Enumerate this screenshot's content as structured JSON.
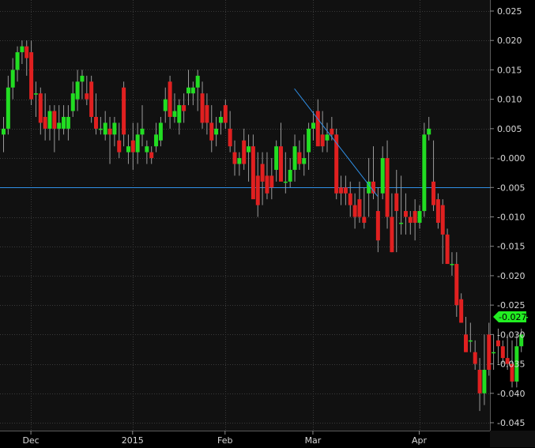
{
  "chart_data": {
    "type": "candlestick",
    "title": "",
    "xlabel": "",
    "ylabel": "",
    "ylim": [
      -0.047,
      0.027
    ],
    "y_ticks": [
      "0.025",
      "0.020",
      "0.015",
      "0.010",
      "0.005",
      "-0.000",
      "-0.005",
      "-0.010",
      "-0.015",
      "-0.020",
      "-0.025",
      "-0.030",
      "-0.035",
      "-0.040",
      "-0.045"
    ],
    "x_ticks": [
      {
        "label": "Dec",
        "index": 6
      },
      {
        "label": "2015",
        "index": 28
      },
      {
        "label": "Feb",
        "index": 48
      },
      {
        "label": "Mar",
        "index": 67
      },
      {
        "label": "Apr",
        "index": 90
      }
    ],
    "grid": "horizontal and vertical, dotted",
    "colors": {
      "up": "#22dd22",
      "down": "#e02020",
      "line": "#2f8fe6",
      "wick": "#9a9a9a",
      "label_bg": "#22ee22"
    },
    "last_value_label": "-0.027",
    "last_value": -0.027,
    "horizontal_line": -0.005,
    "trend_line": {
      "from": {
        "index": 63,
        "y": 0.0118
      },
      "to": {
        "index": 81,
        "y": -0.0065
      }
    },
    "candles": [
      {
        "o": 0.004,
        "h": 0.007,
        "l": 0.001,
        "c": 0.005
      },
      {
        "o": 0.005,
        "h": 0.014,
        "l": 0.004,
        "c": 0.012
      },
      {
        "o": 0.012,
        "h": 0.017,
        "l": 0.01,
        "c": 0.015
      },
      {
        "o": 0.015,
        "h": 0.019,
        "l": 0.013,
        "c": 0.018
      },
      {
        "o": 0.018,
        "h": 0.02,
        "l": 0.016,
        "c": 0.019
      },
      {
        "o": 0.019,
        "h": 0.02,
        "l": 0.014,
        "c": 0.017
      },
      {
        "o": 0.018,
        "h": 0.02,
        "l": 0.009,
        "c": 0.01
      },
      {
        "o": 0.011,
        "h": 0.013,
        "l": 0.007,
        "c": 0.011
      },
      {
        "o": 0.011,
        "h": 0.012,
        "l": 0.004,
        "c": 0.006
      },
      {
        "o": 0.007,
        "h": 0.011,
        "l": 0.003,
        "c": 0.005
      },
      {
        "o": 0.005,
        "h": 0.009,
        "l": 0.003,
        "c": 0.008
      },
      {
        "o": 0.008,
        "h": 0.009,
        "l": 0.001,
        "c": 0.005
      },
      {
        "o": 0.005,
        "h": 0.009,
        "l": 0.003,
        "c": 0.006
      },
      {
        "o": 0.005,
        "h": 0.009,
        "l": 0.004,
        "c": 0.007
      },
      {
        "o": 0.005,
        "h": 0.009,
        "l": 0.003,
        "c": 0.007
      },
      {
        "o": 0.008,
        "h": 0.013,
        "l": 0.007,
        "c": 0.011
      },
      {
        "o": 0.01,
        "h": 0.015,
        "l": 0.008,
        "c": 0.013
      },
      {
        "o": 0.013,
        "h": 0.015,
        "l": 0.01,
        "c": 0.014
      },
      {
        "o": 0.011,
        "h": 0.014,
        "l": 0.009,
        "c": 0.01
      },
      {
        "o": 0.013,
        "h": 0.014,
        "l": 0.006,
        "c": 0.007
      },
      {
        "o": 0.007,
        "h": 0.011,
        "l": 0.004,
        "c": 0.005
      },
      {
        "o": 0.005,
        "h": 0.007,
        "l": 0.004,
        "c": 0.005
      },
      {
        "o": 0.004,
        "h": 0.008,
        "l": 0.003,
        "c": 0.006
      },
      {
        "o": 0.005,
        "h": 0.007,
        "l": -0.001,
        "c": 0.004
      },
      {
        "o": 0.004,
        "h": 0.007,
        "l": 0.002,
        "c": 0.006
      },
      {
        "o": 0.003,
        "h": 0.006,
        "l": 0.0,
        "c": 0.001
      },
      {
        "o": 0.012,
        "h": 0.013,
        "l": 0.002,
        "c": 0.004
      },
      {
        "o": 0.001,
        "h": 0.004,
        "l": -0.001,
        "c": 0.002
      },
      {
        "o": 0.003,
        "h": 0.006,
        "l": -0.002,
        "c": 0.001
      },
      {
        "o": 0.001,
        "h": 0.006,
        "l": -0.001,
        "c": 0.004
      },
      {
        "o": 0.004,
        "h": 0.009,
        "l": 0.002,
        "c": 0.005
      },
      {
        "o": 0.001,
        "h": 0.003,
        "l": -0.001,
        "c": 0.002
      },
      {
        "o": 0.001,
        "h": 0.002,
        "l": -0.001,
        "c": 0.0
      },
      {
        "o": 0.002,
        "h": 0.006,
        "l": 0.001,
        "c": 0.004
      },
      {
        "o": 0.003,
        "h": 0.007,
        "l": 0.002,
        "c": 0.006
      },
      {
        "o": 0.008,
        "h": 0.012,
        "l": 0.006,
        "c": 0.01
      },
      {
        "o": 0.013,
        "h": 0.014,
        "l": 0.005,
        "c": 0.007
      },
      {
        "o": 0.007,
        "h": 0.011,
        "l": 0.006,
        "c": 0.008
      },
      {
        "o": 0.006,
        "h": 0.01,
        "l": 0.004,
        "c": 0.009
      },
      {
        "o": 0.009,
        "h": 0.011,
        "l": 0.006,
        "c": 0.008
      },
      {
        "o": 0.011,
        "h": 0.015,
        "l": 0.009,
        "c": 0.012
      },
      {
        "o": 0.011,
        "h": 0.013,
        "l": 0.009,
        "c": 0.012
      },
      {
        "o": 0.012,
        "h": 0.015,
        "l": 0.008,
        "c": 0.014
      },
      {
        "o": 0.011,
        "h": 0.013,
        "l": 0.005,
        "c": 0.006
      },
      {
        "o": 0.009,
        "h": 0.011,
        "l": 0.004,
        "c": 0.006
      },
      {
        "o": 0.006,
        "h": 0.009,
        "l": 0.001,
        "c": 0.003
      },
      {
        "o": 0.004,
        "h": 0.007,
        "l": 0.002,
        "c": 0.005
      },
      {
        "o": 0.006,
        "h": 0.008,
        "l": 0.004,
        "c": 0.007
      },
      {
        "o": 0.009,
        "h": 0.01,
        "l": 0.005,
        "c": 0.006
      },
      {
        "o": 0.005,
        "h": 0.008,
        "l": 0.001,
        "c": 0.002
      },
      {
        "o": 0.001,
        "h": 0.003,
        "l": -0.003,
        "c": -0.001
      },
      {
        "o": -0.001,
        "h": 0.001,
        "l": -0.003,
        "c": 0.0
      },
      {
        "o": 0.003,
        "h": 0.005,
        "l": -0.002,
        "c": -0.001
      },
      {
        "o": 0.001,
        "h": 0.004,
        "l": -0.004,
        "c": 0.002
      },
      {
        "o": 0.002,
        "h": 0.004,
        "l": -0.006,
        "c": -0.007
      },
      {
        "o": -0.003,
        "h": 0.001,
        "l": -0.01,
        "c": -0.008
      },
      {
        "o": -0.001,
        "h": 0.001,
        "l": -0.008,
        "c": -0.004
      },
      {
        "o": -0.003,
        "h": 0.001,
        "l": -0.007,
        "c": -0.006
      },
      {
        "o": -0.003,
        "h": 0.0,
        "l": -0.007,
        "c": -0.005
      },
      {
        "o": -0.002,
        "h": 0.003,
        "l": -0.004,
        "c": 0.002
      },
      {
        "o": 0.002,
        "h": 0.006,
        "l": -0.003,
        "c": -0.004
      },
      {
        "o": -0.004,
        "h": 0.001,
        "l": -0.006,
        "c": -0.004
      },
      {
        "o": -0.004,
        "h": 0.0,
        "l": -0.005,
        "c": -0.002
      },
      {
        "o": -0.002,
        "h": 0.004,
        "l": -0.004,
        "c": 0.002
      },
      {
        "o": 0.001,
        "h": 0.003,
        "l": -0.002,
        "c": -0.001
      },
      {
        "o": -0.001,
        "h": 0.004,
        "l": -0.003,
        "c": 0.0
      },
      {
        "o": 0.001,
        "h": 0.006,
        "l": -0.002,
        "c": 0.005
      },
      {
        "o": 0.005,
        "h": 0.008,
        "l": 0.003,
        "c": 0.006
      },
      {
        "o": 0.008,
        "h": 0.01,
        "l": 0.003,
        "c": 0.002
      },
      {
        "o": 0.004,
        "h": 0.008,
        "l": 0.001,
        "c": 0.002
      },
      {
        "o": 0.003,
        "h": 0.006,
        "l": 0.001,
        "c": 0.004
      },
      {
        "o": 0.005,
        "h": 0.007,
        "l": 0.003,
        "c": 0.004
      },
      {
        "o": 0.004,
        "h": 0.005,
        "l": -0.007,
        "c": -0.006
      },
      {
        "o": -0.005,
        "h": -0.003,
        "l": -0.008,
        "c": -0.006
      },
      {
        "o": -0.005,
        "h": -0.003,
        "l": -0.008,
        "c": -0.006
      },
      {
        "o": -0.006,
        "h": -0.004,
        "l": -0.01,
        "c": -0.008
      },
      {
        "o": -0.008,
        "h": -0.006,
        "l": -0.012,
        "c": -0.01
      },
      {
        "o": -0.007,
        "h": -0.004,
        "l": -0.011,
        "c": -0.01
      },
      {
        "o": -0.01,
        "h": -0.005,
        "l": -0.012,
        "c": -0.011
      },
      {
        "o": -0.006,
        "h": 0.0,
        "l": -0.01,
        "c": -0.004
      },
      {
        "o": -0.004,
        "h": 0.002,
        "l": -0.007,
        "c": -0.006
      },
      {
        "o": -0.009,
        "h": -0.005,
        "l": -0.016,
        "c": -0.014
      }
    ],
    "candles_tail": [
      {
        "o": -0.006,
        "h": 0.002,
        "l": -0.007,
        "c": 0.0
      },
      {
        "o": 0.0,
        "h": 0.003,
        "l": -0.012,
        "c": -0.01
      },
      {
        "o": -0.01,
        "h": -0.006,
        "l": -0.016,
        "c": -0.016
      },
      {
        "o": -0.006,
        "h": -0.002,
        "l": -0.016,
        "c": -0.009
      },
      {
        "o": -0.011,
        "h": -0.003,
        "l": -0.013,
        "c": -0.011
      },
      {
        "o": -0.009,
        "h": -0.006,
        "l": -0.013,
        "c": -0.01
      },
      {
        "o": -0.01,
        "h": -0.009,
        "l": -0.013,
        "c": -0.011
      },
      {
        "o": -0.009,
        "h": -0.007,
        "l": -0.014,
        "c": -0.011
      },
      {
        "o": -0.011,
        "h": -0.008,
        "l": -0.012,
        "c": -0.009
      },
      {
        "o": -0.009,
        "h": 0.006,
        "l": -0.01,
        "c": 0.004
      },
      {
        "o": 0.004,
        "h": 0.007,
        "l": 0.003,
        "c": 0.005
      },
      {
        "o": -0.004,
        "h": 0.003,
        "l": -0.009,
        "c": -0.008
      },
      {
        "o": -0.007,
        "h": -0.006,
        "l": -0.012,
        "c": -0.011
      },
      {
        "o": -0.008,
        "h": -0.007,
        "l": -0.018,
        "c": -0.013
      },
      {
        "o": -0.013,
        "h": -0.012,
        "l": -0.018,
        "c": -0.018
      },
      {
        "o": -0.018,
        "h": -0.016,
        "l": -0.02,
        "c": -0.018
      },
      {
        "o": -0.018,
        "h": -0.016,
        "l": -0.027,
        "c": -0.025
      },
      {
        "o": -0.024,
        "h": -0.023,
        "l": -0.028,
        "c": -0.028
      },
      {
        "o": -0.03,
        "h": -0.027,
        "l": -0.033,
        "c": -0.033
      },
      {
        "o": -0.031,
        "h": -0.028,
        "l": -0.033,
        "c": -0.031
      },
      {
        "o": -0.033,
        "h": -0.031,
        "l": -0.036,
        "c": -0.035
      },
      {
        "o": -0.036,
        "h": -0.034,
        "l": -0.043,
        "c": -0.04
      },
      {
        "o": -0.04,
        "h": -0.03,
        "l": -0.042,
        "c": -0.036
      },
      {
        "o": -0.03,
        "h": -0.028,
        "l": -0.037,
        "c": -0.036
      },
      {
        "o": -0.033,
        "h": -0.03,
        "l": -0.036,
        "c": -0.033
      },
      {
        "o": -0.031,
        "h": -0.029,
        "l": -0.035,
        "c": -0.032
      },
      {
        "o": -0.032,
        "h": -0.031,
        "l": -0.035,
        "c": -0.034
      },
      {
        "o": -0.034,
        "h": -0.03,
        "l": -0.036,
        "c": -0.035
      },
      {
        "o": -0.035,
        "h": -0.031,
        "l": -0.039,
        "c": -0.038
      },
      {
        "o": -0.038,
        "h": -0.03,
        "l": -0.039,
        "c": -0.032
      },
      {
        "o": -0.032,
        "h": -0.029,
        "l": -0.033,
        "c": -0.03
      },
      {
        "o": -0.027,
        "h": -0.027,
        "l": -0.027,
        "c": -0.027
      }
    ]
  }
}
